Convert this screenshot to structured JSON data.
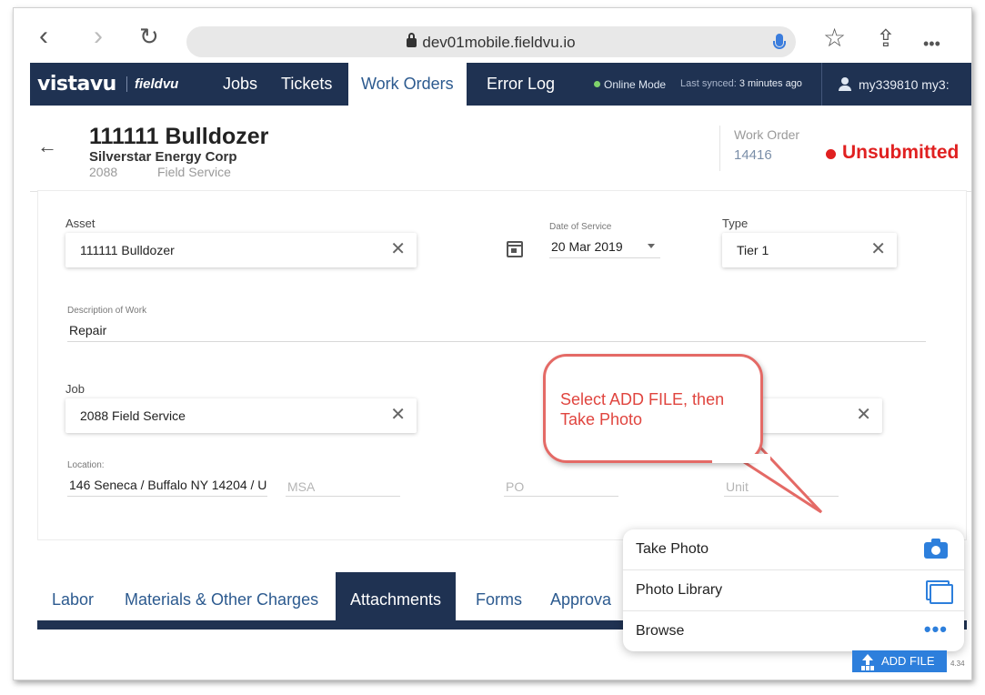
{
  "browser": {
    "back_glyph": "‹",
    "forward_glyph": "›",
    "reload_glyph": "↻",
    "url": "dev01mobile.fieldvu.io",
    "star_glyph": "☆",
    "share_glyph": "⇪",
    "more_glyph": "•••"
  },
  "app_nav": {
    "logo_main": "vistavu",
    "logo_sub": "fieldvu",
    "items": [
      {
        "label": "Jobs",
        "active": false
      },
      {
        "label": "Tickets",
        "active": false
      },
      {
        "label": "Work Orders",
        "active": true
      },
      {
        "label": "Error Log",
        "active": false
      }
    ],
    "online_mode": "Online Mode",
    "last_synced_label": "Last synced:",
    "last_synced_value": "3 minutes ago",
    "user": "my339810 my3:"
  },
  "header": {
    "asset_title": "111111 Bulldozer",
    "company": "Silverstar Energy Corp",
    "job_number": "2088",
    "job_name": "Field Service",
    "wo_label": "Work Order",
    "wo_number": "14416",
    "status": "Unsubmitted",
    "status_color": "#e02020"
  },
  "form": {
    "asset_label": "Asset",
    "asset_value": "111111   Bulldozer",
    "date_label": "Date of Service",
    "date_value": "20 Mar 2019",
    "type_label": "Type",
    "type_value": "Tier 1",
    "description_label": "Description of Work",
    "description_value": "Repair",
    "job_label": "Job",
    "job_value": "2088   Field Service",
    "location_label": "Location:",
    "location_value": "146 Seneca / Buffalo NY 14204 / U",
    "msa_placeholder": "MSA",
    "po_placeholder": "PO",
    "unit_placeholder": "Unit"
  },
  "callout": {
    "text": "Select ADD FILE, then Take Photo",
    "color": "#e0453f"
  },
  "tabs": [
    {
      "label": "Labor",
      "active": false
    },
    {
      "label": "Materials & Other Charges",
      "active": false
    },
    {
      "label": "Attachments",
      "active": true
    },
    {
      "label": "Forms",
      "active": false
    },
    {
      "label": "Approva",
      "active": false
    }
  ],
  "popover": {
    "items": [
      {
        "label": "Take Photo",
        "icon": "camera-icon"
      },
      {
        "label": "Photo Library",
        "icon": "photo-library-icon"
      },
      {
        "label": "Browse",
        "icon": "more-dots-icon"
      }
    ]
  },
  "add_file": {
    "label": "ADD FILE",
    "version": "4.34"
  },
  "colors": {
    "nav_bg": "#1f3252",
    "accent": "#2d7fdc",
    "link": "#2c5a8f"
  }
}
